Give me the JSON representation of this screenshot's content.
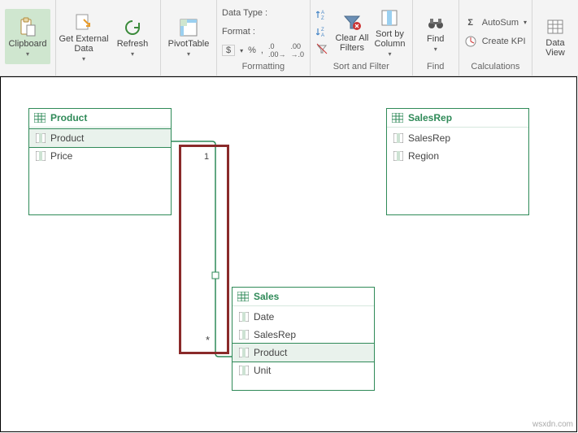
{
  "ribbon": {
    "groups": {
      "clipboard": {
        "btn_clipboard": "Clipboard"
      },
      "external": {
        "btn_getdata": "Get External\nData",
        "btn_refresh": "Refresh"
      },
      "pivot": {
        "btn_pivot": "PivotTable"
      },
      "formatting": {
        "row_datatype": "Data Type :",
        "row_format": "Format :",
        "s_dollar": "$",
        "s_pct": "%",
        "s_comma": ",",
        "s_dec_inc": ".0",
        "s_dec_dec": ".00",
        "label": "Formatting"
      },
      "sort": {
        "btn_clear": "Clear All\nFilters",
        "btn_column": "Sort by\nColumn",
        "label": "Sort and Filter"
      },
      "find": {
        "btn_find": "Find",
        "label": "Find"
      },
      "calc": {
        "row_autosum": "AutoSum",
        "row_kpi": "Create KPI",
        "label": "Calculations"
      },
      "view": {
        "btn_dataview": "Data\nView"
      }
    }
  },
  "diagram": {
    "tables": {
      "product": {
        "title": "Product",
        "fields": [
          "Product",
          "Price"
        ]
      },
      "salesrep": {
        "title": "SalesRep",
        "fields": [
          "SalesRep",
          "Region"
        ]
      },
      "sales": {
        "title": "Sales",
        "fields": [
          "Date",
          "SalesRep",
          "Product",
          "Unit"
        ]
      }
    },
    "relationship": {
      "end_one": "1",
      "end_many": "*"
    }
  },
  "watermark": "wsxdn.com"
}
